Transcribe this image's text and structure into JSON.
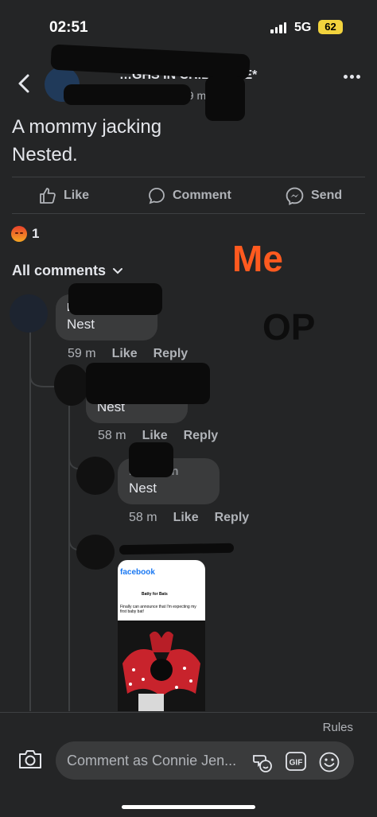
{
  "status_bar": {
    "time": "02:51",
    "network": "5G",
    "battery": "62"
  },
  "header": {
    "group_name": "…GHS IN CHILDFREE*",
    "time": "59 m"
  },
  "post": {
    "text": "A mommy jacking\nNested."
  },
  "actions": {
    "like": "Like",
    "comment": "Comment",
    "send": "Send"
  },
  "reactions": {
    "count": "1"
  },
  "comments_header": {
    "label": "All comments"
  },
  "overlays": {
    "me": "Me",
    "op": "OP"
  },
  "comments": [
    {
      "name": "B",
      "text": "Nest",
      "time": "59 m",
      "like": "Like",
      "reply": "Reply"
    },
    {
      "name": "",
      "text": "Nest",
      "time": "58 m",
      "like": "Like",
      "reply": "Reply"
    },
    {
      "name": "B…nnon",
      "text": "Nest",
      "time": "58 m",
      "like": "Like",
      "reply": "Reply"
    }
  ],
  "attached_image": {
    "app": "facebook",
    "post_name": "Batty for Bats",
    "post_text": "Finally can announce that I'm expecting my first baby bat!"
  },
  "footer": {
    "rules": "Rules",
    "placeholder": "Comment as Connie Jen..."
  },
  "colors": {
    "background": "#242526",
    "bubble": "#3a3b3c",
    "accent_me": "#ff5a1f",
    "battery": "#f2d33d"
  }
}
